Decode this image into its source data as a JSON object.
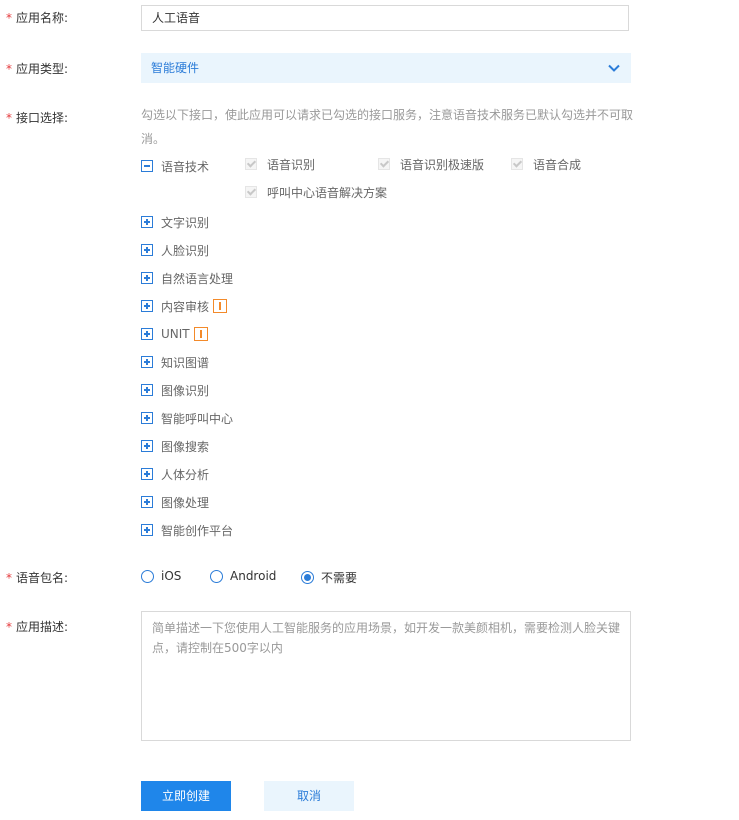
{
  "form": {
    "name_label": "应用名称:",
    "name_value": "人工语音",
    "type_label": "应用类型:",
    "type_value": "智能硬件",
    "api_label": "接口选择:",
    "api_hint": "勾选以下接口，使此应用可以请求已勾选的接口服务，注意语音技术服务已默认勾选并不可取消。",
    "package_label": "语音包名:",
    "desc_label": "应用描述:",
    "desc_placeholder": "简单描述一下您使用人工智能服务的应用场景，如开发一款美颜相机，需要检测人脸关键点，请控制在500字以内",
    "required_mark": "*"
  },
  "api_groups": [
    {
      "label": "语音技术",
      "expanded": true
    },
    {
      "label": "文字识别"
    },
    {
      "label": "人脸识别"
    },
    {
      "label": "自然语言处理"
    },
    {
      "label": "内容审核",
      "warning": true
    },
    {
      "label": "UNIT",
      "warning": true
    },
    {
      "label": "知识图谱"
    },
    {
      "label": "图像识别"
    },
    {
      "label": "智能呼叫中心"
    },
    {
      "label": "图像搜索"
    },
    {
      "label": "人体分析"
    },
    {
      "label": "图像处理"
    },
    {
      "label": "智能创作平台"
    }
  ],
  "speech_items": [
    "语音识别",
    "语音识别极速版",
    "语音合成",
    "呼叫中心语音解决方案"
  ],
  "package_options": [
    {
      "label": "iOS",
      "selected": false
    },
    {
      "label": "Android",
      "selected": false
    },
    {
      "label": "不需要",
      "selected": true
    }
  ],
  "buttons": {
    "create": "立即创建",
    "cancel": "取消"
  },
  "colors": {
    "accent": "#1f86ea",
    "required": "#e4393c",
    "warning": "#f38a2a"
  }
}
